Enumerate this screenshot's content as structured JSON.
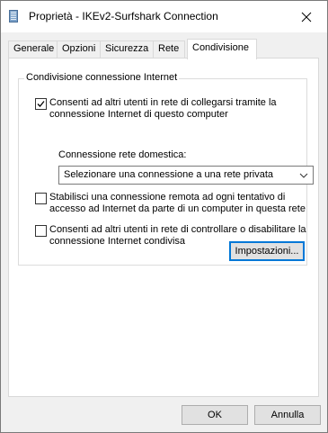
{
  "window": {
    "title": "Proprietà - IKEv2-Surfshark Connection"
  },
  "tabs": [
    {
      "label": "Generale"
    },
    {
      "label": "Opzioni"
    },
    {
      "label": "Sicurezza"
    },
    {
      "label": "Rete"
    },
    {
      "label": "Condivisione"
    }
  ],
  "active_tab": "Condivisione",
  "group": {
    "title": "Condivisione connessione Internet",
    "options": [
      {
        "label": "Consenti ad altri utenti in rete di collegarsi tramite la connessione Internet di questo computer",
        "checked": true
      },
      {
        "label": "Stabilisci una connessione remota ad ogni tentativo di accesso ad Internet da parte di un computer in questa rete",
        "checked": false
      },
      {
        "label": "Consenti ad altri utenti in rete di controllare o disabilitare la connessione Internet condivisa",
        "checked": false
      }
    ],
    "home_network_label": "Connessione rete domestica:",
    "home_network_value": "Selezionare una connessione a una rete privata",
    "settings_button": "Impostazioni..."
  },
  "footer": {
    "ok_label": "OK",
    "cancel_label": "Annulla"
  },
  "icons": {
    "app": "network-connection-icon",
    "close": "close-icon",
    "check": "check-icon",
    "dropdown": "chevron-down-icon"
  },
  "colors": {
    "focus_border": "#0078d7",
    "window_bg": "#f0f0f0",
    "panel_bg": "#ffffff"
  }
}
